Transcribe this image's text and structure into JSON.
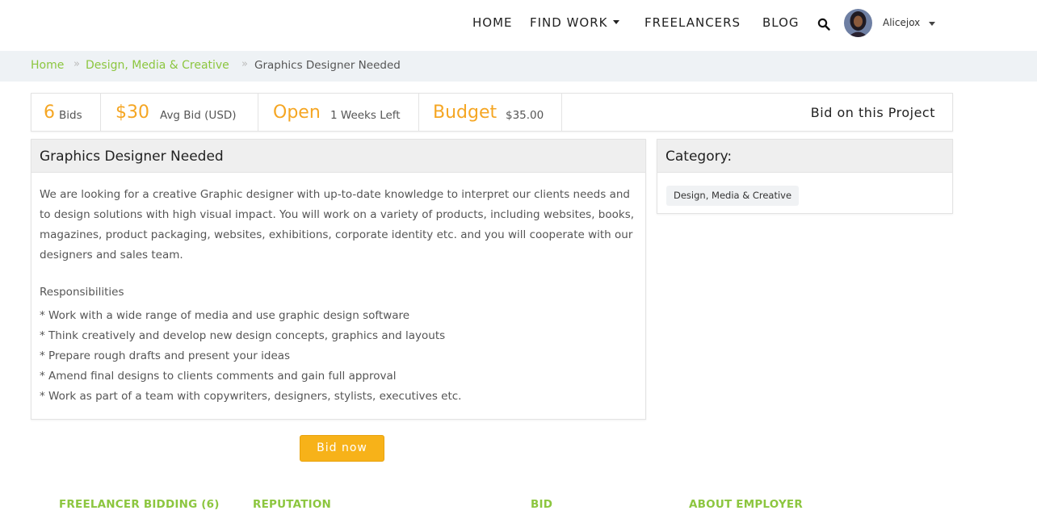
{
  "nav": {
    "home": "HOME",
    "find_work": "FIND WORK",
    "freelancers": "FREELANCERS",
    "blog": "BLOG",
    "search_icon": "search-icon",
    "username": "Alicejox"
  },
  "breadcrumb": {
    "home": "Home",
    "category": "Design, Media & Creative",
    "current": "Graphics Designer Needed",
    "separator": "»"
  },
  "stats": {
    "bids_count": "6",
    "bids_label": "Bids",
    "avg_bid": "$30",
    "avg_bid_label": "Avg Bid (USD)",
    "status": "Open",
    "time_left": "1 Weeks Left",
    "budget_label": "Budget",
    "budget_value": "$35.00",
    "bid_on_project": "Bid on this Project"
  },
  "project": {
    "title": "Graphics Designer Needed",
    "description": "We are looking for a creative Graphic designer with up-to-date knowledge to interpret our clients needs and to design solutions with high visual impact. You will work on a variety of products, including websites, books, magazines, product packaging, websites, exhibitions, corporate identity etc. and you will cooperate with our designers and sales team.",
    "responsibilities_title": "Responsibilities",
    "responsibilities": [
      "* Work with a wide range of media and use graphic design software",
      "* Think creatively and develop new design concepts, graphics and layouts",
      "* Prepare rough drafts and present your ideas",
      "* Amend final designs to clients comments and gain full approval",
      "* Work as part of a team with copywriters, designers, stylists, executives etc."
    ]
  },
  "category": {
    "title": "Category:",
    "tag": "Design, Media & Creative"
  },
  "actions": {
    "bid_now": "Bid now"
  },
  "tabs": {
    "freelancer_bidding": "FREELANCER BIDDING (6)",
    "reputation": "REPUTATION",
    "bid": "BID",
    "about_employer": "ABOUT EMPLOYER"
  },
  "colors": {
    "accent_green": "#8cc63f",
    "accent_orange": "#f5a623",
    "button_orange": "#f7b219"
  }
}
